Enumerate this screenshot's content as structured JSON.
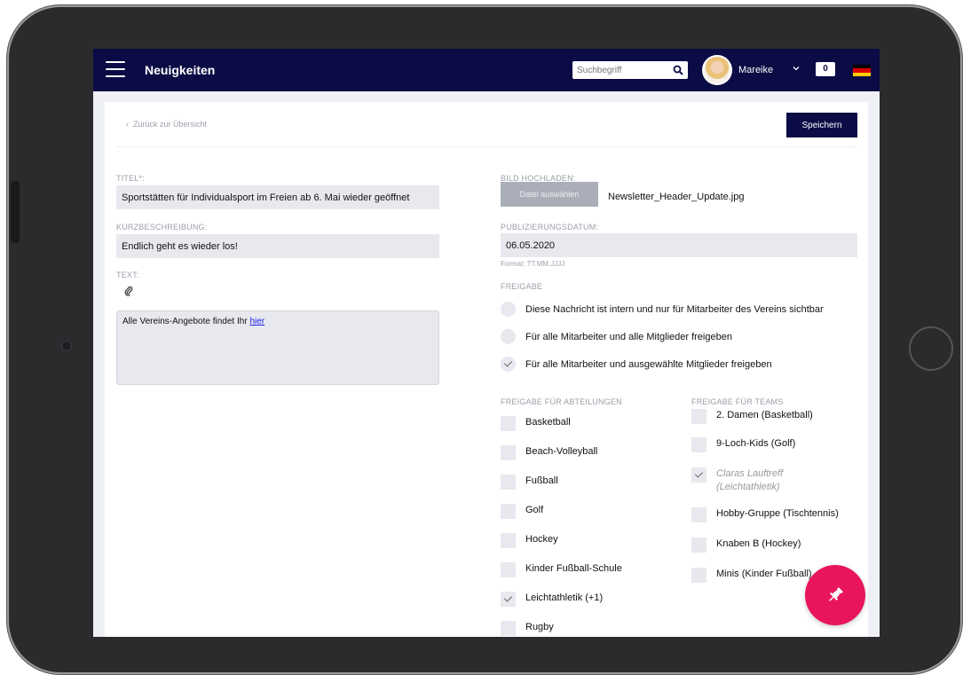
{
  "header": {
    "title": "Neuigkeiten",
    "search_placeholder": "Suchbegriff",
    "user_name": "Mareike",
    "notification_count": "0"
  },
  "toolbar": {
    "back_label": "Zurück zur Übersicht",
    "save_label": "Speichern"
  },
  "form": {
    "title_label": "TITEL*:",
    "title_value": "Sportstätten für Individualsport im Freien ab 6. Mai wieder geöffnet",
    "short_label": "KURZBESCHREIBUNG:",
    "short_value": "Endlich geht es wieder los!",
    "text_label": "TEXT:",
    "text_body": "Alle Vereins-Angebote findet Ihr ",
    "text_link": "hier",
    "image_label": "BILD HOCHLADEN:",
    "file_button": "Datei auswählen",
    "file_name": "Newsletter_Header_Update.jpg",
    "date_label": "PUBLIZIERUNGSDATUM:",
    "date_value": "06.05.2020",
    "date_hint": "Format: TT.MM.JJJJ",
    "release_label": "FREIGABE",
    "release_options": [
      {
        "label": "Diese Nachricht ist intern und nur für Mitarbeiter des Vereins sichtbar",
        "checked": false
      },
      {
        "label": "Für alle Mitarbeiter und alle Mitglieder freigeben",
        "checked": false
      },
      {
        "label": "Für alle Mitarbeiter und ausgewählte Mitglieder freigeben",
        "checked": true
      }
    ],
    "departments_label": "FREIGABE FÜR ABTEILUNGEN",
    "departments": [
      {
        "label": "Basketball",
        "checked": false
      },
      {
        "label": "Beach-Volleyball",
        "checked": false
      },
      {
        "label": "Fußball",
        "checked": false
      },
      {
        "label": "Golf",
        "checked": false
      },
      {
        "label": "Hockey",
        "checked": false
      },
      {
        "label": "Kinder Fußball-Schule",
        "checked": false
      },
      {
        "label": "Leichtathletik (+1)",
        "checked": true
      },
      {
        "label": "Rugby",
        "checked": false
      }
    ],
    "teams_label": "FREIGABE FÜR TEAMS",
    "teams": [
      {
        "label": "2. Damen (Basketball)",
        "checked": false
      },
      {
        "label": "9-Loch-Kids (Golf)",
        "checked": false
      },
      {
        "label": "Claras Lauftreff (Leichtathletik)",
        "checked": true
      },
      {
        "label": "Hobby-Gruppe (Tischtennis)",
        "checked": false
      },
      {
        "label": "Knaben B (Hockey)",
        "checked": false
      },
      {
        "label": "Minis (Kinder Fußball)",
        "checked": false
      }
    ]
  },
  "colors": {
    "navbar": "#0b0b45",
    "fab": "#e8155e",
    "field_bg": "#e8e9ee"
  },
  "icons": {
    "menu": "hamburger-icon",
    "search": "search-icon",
    "attach": "paperclip-icon",
    "fab": "pin-icon",
    "language": "german-flag-icon"
  }
}
